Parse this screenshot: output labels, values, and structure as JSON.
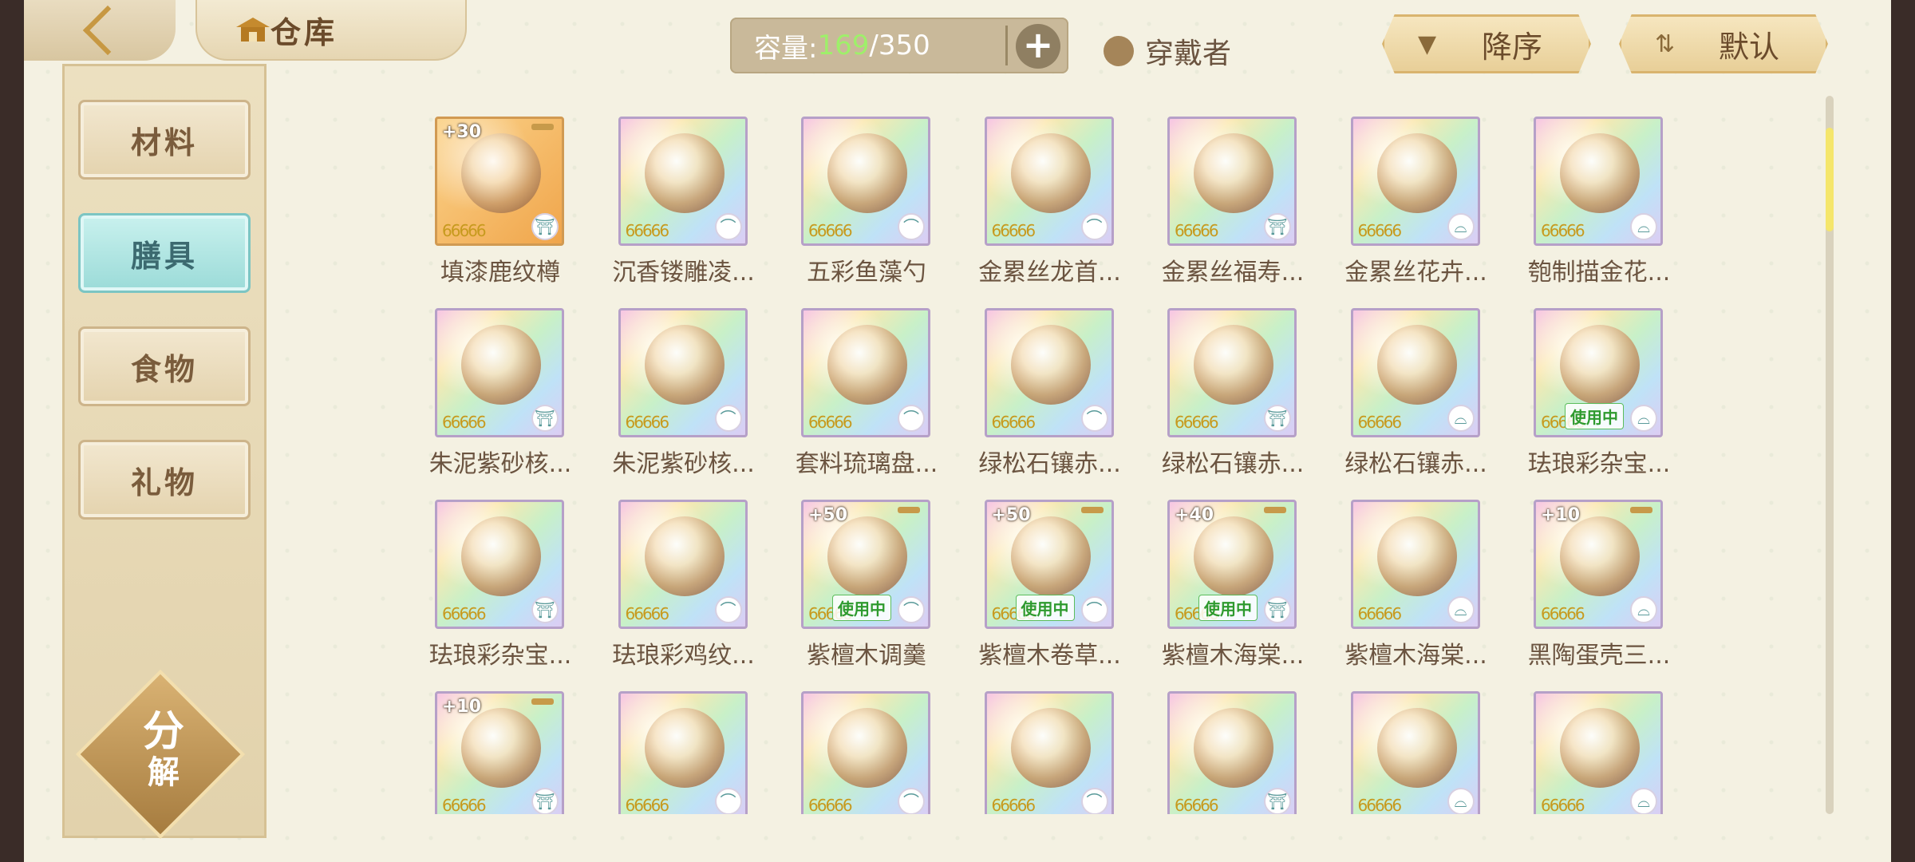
{
  "header": {
    "title": "仓库",
    "capacity_label": "容量:",
    "capacity_used": "169",
    "capacity_total": "/350",
    "wearer_label": "穿戴者",
    "sort_desc_label": "降序",
    "sort_default_label": "默认"
  },
  "sidebar": {
    "items": [
      {
        "label": "材料"
      },
      {
        "label": "膳具"
      },
      {
        "label": "食物"
      },
      {
        "label": "礼物"
      }
    ],
    "active_index": 1,
    "decompose_top": "分",
    "decompose_bottom": "解"
  },
  "colors": {
    "accent": "#9ef06a",
    "active_tab": "#9bdbd8"
  },
  "items": [
    {
      "name": "填漆鹿纹樽",
      "level": "+30",
      "in_use": false
    },
    {
      "name": "沉香镂雕凌...",
      "level": "",
      "in_use": false
    },
    {
      "name": "五彩鱼藻勺",
      "level": "",
      "in_use": false
    },
    {
      "name": "金累丝龙首...",
      "level": "",
      "in_use": false
    },
    {
      "name": "金累丝福寿...",
      "level": "",
      "in_use": false
    },
    {
      "name": "金累丝花卉...",
      "level": "",
      "in_use": false
    },
    {
      "name": "匏制描金花...",
      "level": "",
      "in_use": false
    },
    {
      "name": "朱泥紫砂核...",
      "level": "",
      "in_use": false
    },
    {
      "name": "朱泥紫砂核...",
      "level": "",
      "in_use": false
    },
    {
      "name": "套料琉璃盘...",
      "level": "",
      "in_use": false
    },
    {
      "name": "绿松石镶赤...",
      "level": "",
      "in_use": false
    },
    {
      "name": "绿松石镶赤...",
      "level": "",
      "in_use": false
    },
    {
      "name": "绿松石镶赤...",
      "level": "",
      "in_use": false
    },
    {
      "name": "珐琅彩杂宝...",
      "level": "",
      "in_use": true
    },
    {
      "name": "珐琅彩杂宝...",
      "level": "",
      "in_use": false
    },
    {
      "name": "珐琅彩鸡纹...",
      "level": "",
      "in_use": false
    },
    {
      "name": "紫檀木调羹",
      "level": "+50",
      "in_use": true
    },
    {
      "name": "紫檀木卷草...",
      "level": "+50",
      "in_use": true
    },
    {
      "name": "紫檀木海棠...",
      "level": "+40",
      "in_use": true
    },
    {
      "name": "紫檀木海棠...",
      "level": "",
      "in_use": false
    },
    {
      "name": "黑陶蛋壳三...",
      "level": "+10",
      "in_use": false
    },
    {
      "name": "",
      "level": "+10",
      "in_use": false
    },
    {
      "name": "",
      "level": "",
      "in_use": false
    },
    {
      "name": "",
      "level": "",
      "in_use": false
    },
    {
      "name": "",
      "level": "",
      "in_use": false
    },
    {
      "name": "",
      "level": "",
      "in_use": false
    },
    {
      "name": "",
      "level": "",
      "in_use": false
    },
    {
      "name": "",
      "level": "",
      "in_use": false
    }
  ],
  "in_use_label": "使用中",
  "stars": "66666"
}
